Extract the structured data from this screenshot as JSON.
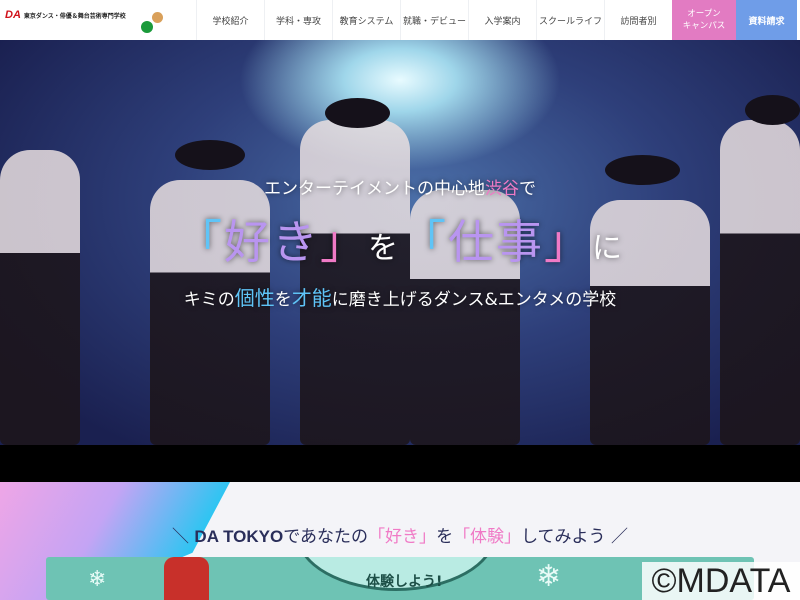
{
  "header": {
    "logo_mark": "DA",
    "logo_name": "東京ダンス・俳優＆舞台芸術専門学校",
    "nav": [
      "学校紹介",
      "学科・専攻",
      "教育システム",
      "就職・デビュー",
      "入学案内",
      "スクールライフ",
      "訪問者別"
    ],
    "open_campus": [
      "オープン",
      "キャンパス"
    ],
    "request": "資料請求"
  },
  "hero": {
    "line1_prefix": "エンターテイメントの中心地",
    "line1_highlight": "渋谷",
    "line1_suffix": "で",
    "line2": {
      "b1": "「",
      "w1": "好き",
      "b2": "」",
      "p1": "を",
      "b3": "「",
      "w2": "仕事",
      "b4": "」",
      "p2": "に"
    },
    "line3": {
      "a": "キミの",
      "h1": "個性",
      "b": "を",
      "h2": "才能",
      "c": "に磨き上げるダンス&エンタメの学校"
    }
  },
  "section": {
    "slash_left": "＼",
    "brand": "DA TOKYO",
    "mid": "であなたの",
    "q1": "「好き」",
    "wo": "を",
    "q2": "「体験」",
    "end": "してみよう",
    "slash_right": "／",
    "banner_text": "体験しよう!"
  },
  "watermark": "©MDATA"
}
